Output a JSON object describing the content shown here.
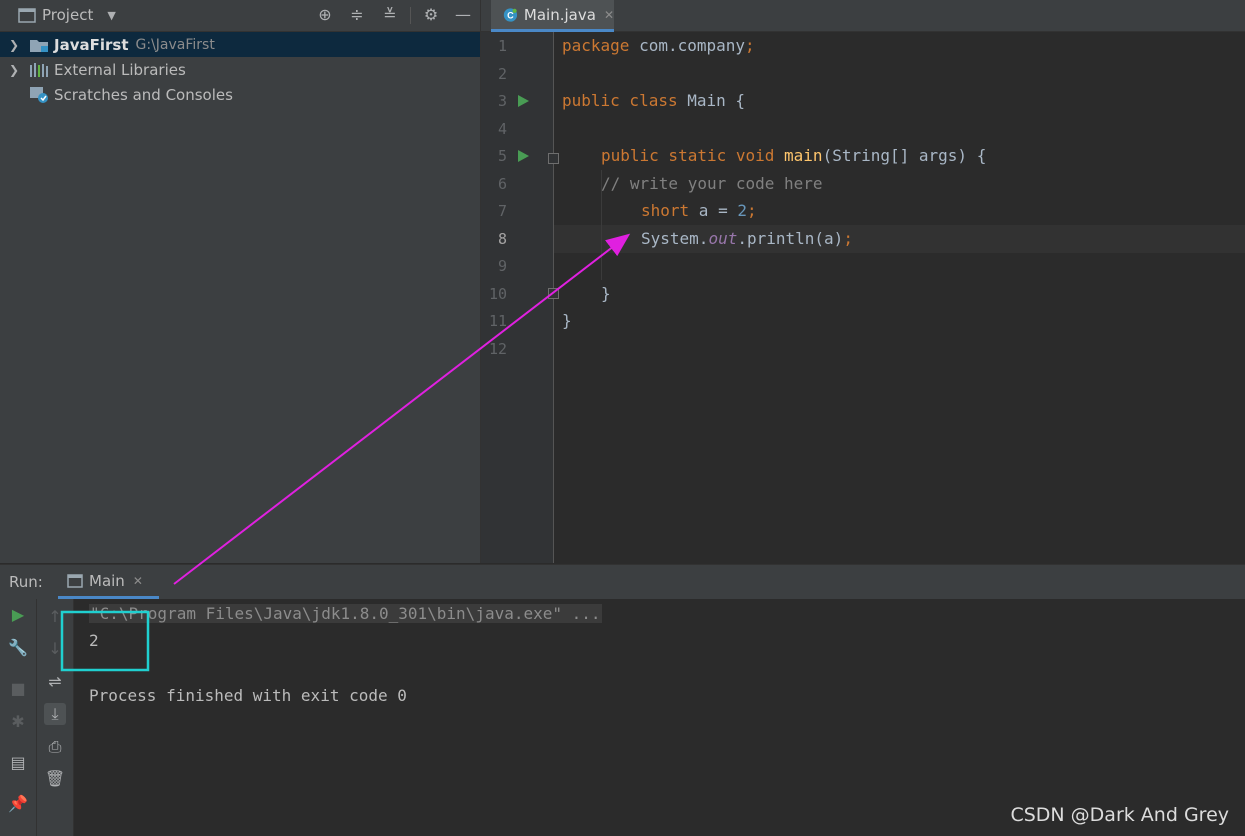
{
  "project_panel": {
    "title": "Project",
    "tree": [
      {
        "label": "JavaFirst",
        "path": "G:\\JavaFirst"
      },
      {
        "label": "External Libraries"
      },
      {
        "label": "Scratches and Consoles"
      }
    ]
  },
  "editor": {
    "tab_label": "Main.java",
    "line_numbers": [
      "1",
      "2",
      "3",
      "4",
      "5",
      "6",
      "7",
      "8",
      "9",
      "10",
      "11",
      "12"
    ],
    "code": {
      "l1_kw": "package",
      "l1_rest": " com.company",
      "l1_semi": ";",
      "l3_kw": "public class",
      "l3_rest": " Main {",
      "l5_kw": "public static void",
      "l5_fn": "main",
      "l5_rest": "(String[] args) {",
      "l6_comment": "// write your code here",
      "l7_kw": "short",
      "l7_rest": " a = ",
      "l7_num": "2",
      "l7_semi": ";",
      "l8_a": "System.",
      "l8_field": "out",
      "l8_b": ".println(a)",
      "l8_semi": ";",
      "l10": "}",
      "l11": "}"
    }
  },
  "run_panel": {
    "label": "Run:",
    "tab_label": "Main",
    "console": {
      "command": "\"C:\\Program Files\\Java\\jdk1.8.0_301\\bin\\java.exe\" ...",
      "output": "2",
      "exit": "Process finished with exit code 0"
    }
  },
  "watermark": "CSDN @Dark And Grey",
  "colors": {
    "annotation_arrow": "#e020e0",
    "annotation_box": "#20d0d0",
    "tab_underline": "#4a88c7",
    "run_green": "#499c54"
  }
}
